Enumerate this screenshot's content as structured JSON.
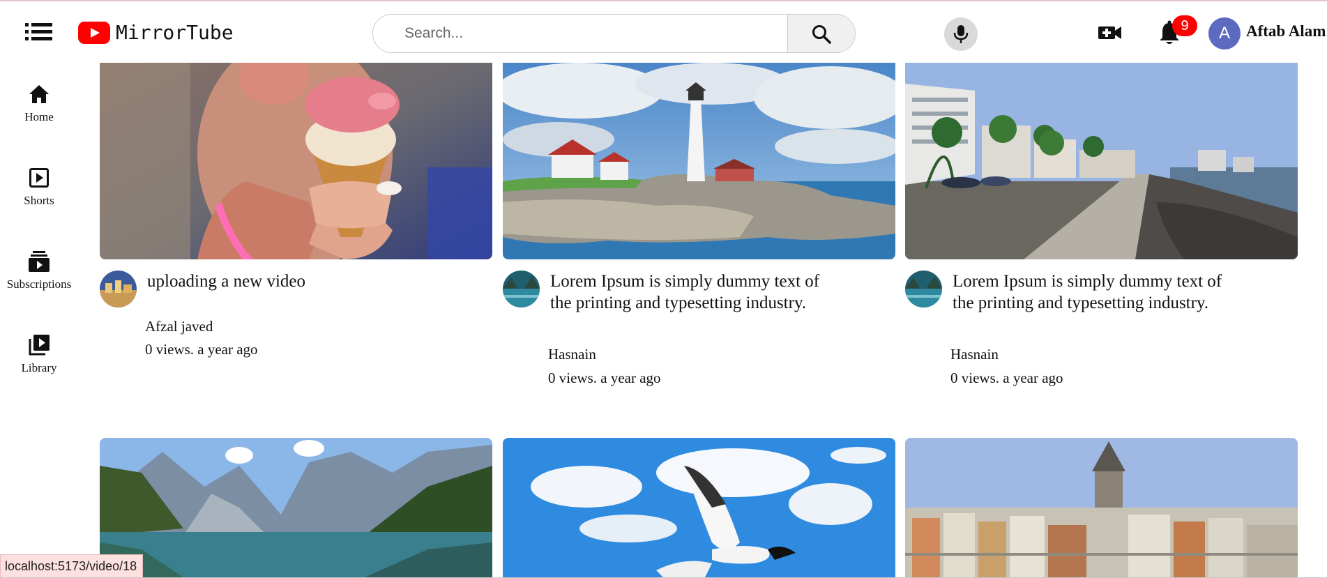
{
  "app": {
    "name": "MirrorTube",
    "logo_icon": "play-logo-icon",
    "brand_color": "#ff0000"
  },
  "header": {
    "menu_icon": "hamburger-menu-icon",
    "search": {
      "placeholder": "Search...",
      "value": ""
    },
    "search_icon": "search-icon",
    "mic_icon": "mic-icon",
    "create_icon": "video-camera-plus-icon",
    "notifications": {
      "icon": "bell-icon",
      "count": "9"
    },
    "user": {
      "initial": "A",
      "name": "Aftab Alam",
      "avatar_color": "#5c6bc0"
    }
  },
  "sidebar": {
    "items": [
      {
        "label": "Home",
        "icon": "home-icon"
      },
      {
        "label": "Shorts",
        "icon": "shorts-play-icon"
      },
      {
        "label": "Subscriptions",
        "icon": "subscriptions-icon"
      },
      {
        "label": "Library",
        "icon": "library-icon"
      }
    ]
  },
  "videos": [
    {
      "title": "uploading a new video",
      "channel": "Afzal javed",
      "meta": "0 views. a year ago",
      "thumbnail": "ice cream cone"
    },
    {
      "title": "Lorem Ipsum is simply dummy text of the printing and typesetting industry.",
      "channel": "Hasnain",
      "meta": "0 views. a year ago",
      "thumbnail": "lighthouse on rocky coast"
    },
    {
      "title": "Lorem Ipsum is simply dummy text of the printing and typesetting industry.",
      "channel": "Hasnain",
      "meta": "0 views. a year ago",
      "thumbnail": "seaside promenade"
    },
    {
      "thumbnail": "mountain lake"
    },
    {
      "thumbnail": "stork in blue sky"
    },
    {
      "thumbnail": "city with tower"
    }
  ],
  "status_bar": {
    "url": "localhost:5173/video/18"
  }
}
